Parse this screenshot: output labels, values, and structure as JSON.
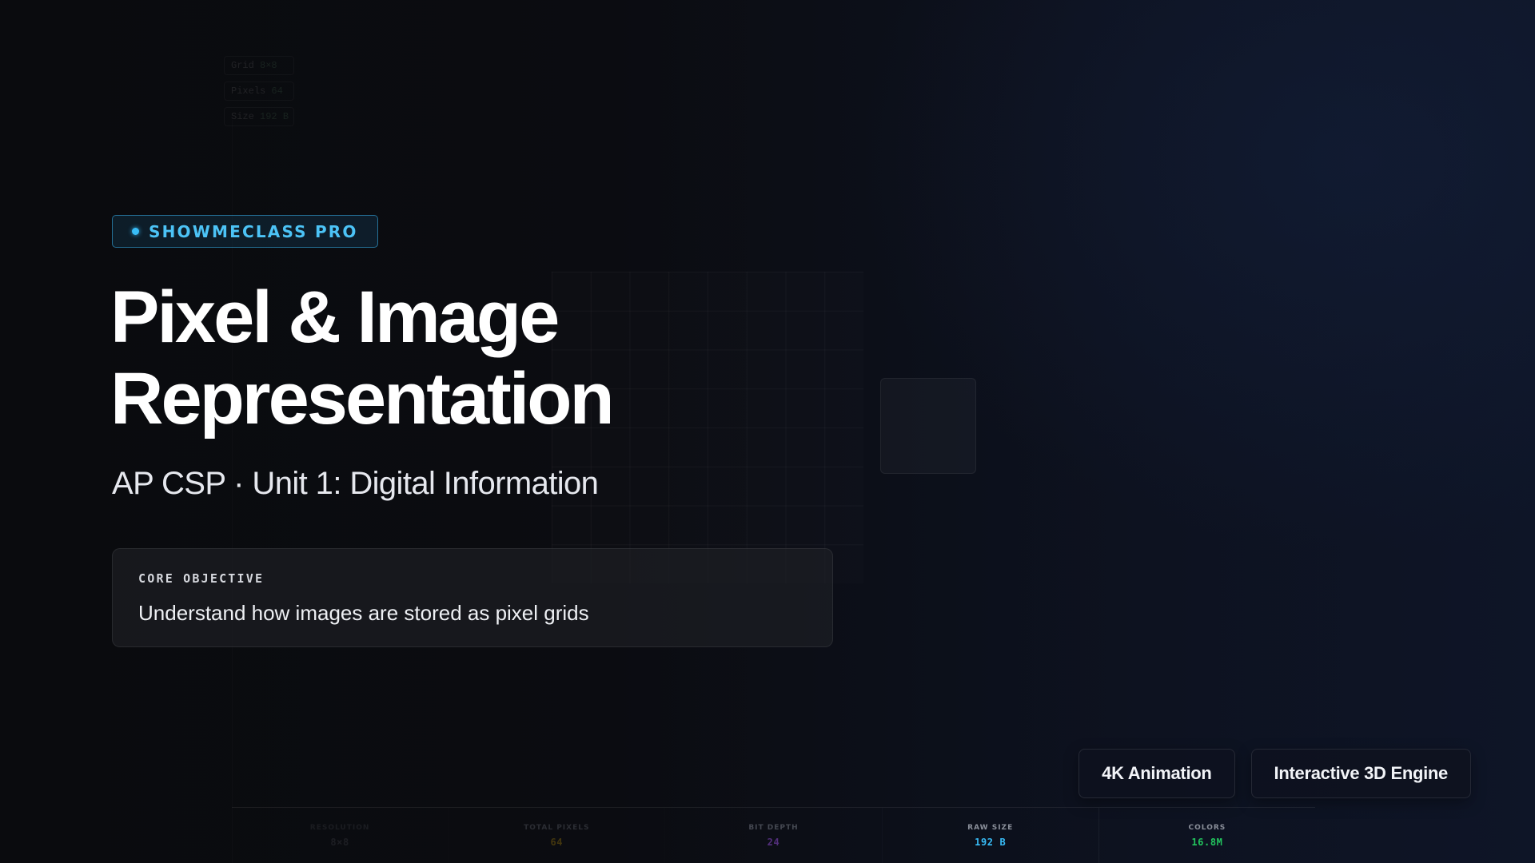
{
  "badge": {
    "label": "SHOWMECLASS PRO"
  },
  "title": {
    "line1": "Pixel & Image",
    "line2": "Representation"
  },
  "subtitle": "AP CSP · Unit 1: Digital Information",
  "objective": {
    "label": "CORE OBJECTIVE",
    "text": "Understand how images are stored as pixel grids"
  },
  "ghost_stats": [
    {
      "label": "Grid",
      "value": "8×8"
    },
    {
      "label": "Pixels",
      "value": "64"
    },
    {
      "label": "Size",
      "value": "192 B"
    }
  ],
  "features": [
    {
      "label": "4K Animation"
    },
    {
      "label": "Interactive 3D Engine"
    }
  ],
  "stats": [
    {
      "label": "RESOLUTION",
      "value": "8×8",
      "color": "#9aa0aa"
    },
    {
      "label": "TOTAL PIXELS",
      "value": "64",
      "color": "#eab308"
    },
    {
      "label": "BIT DEPTH",
      "value": "24",
      "color": "#a855f7"
    },
    {
      "label": "RAW SIZE",
      "value": "192 B",
      "color": "#38bdf8"
    },
    {
      "label": "COLORS",
      "value": "16.8M",
      "color": "#22c55e"
    }
  ],
  "colors": {
    "accent": "#38bdf8",
    "background": "#0a0b0f"
  }
}
